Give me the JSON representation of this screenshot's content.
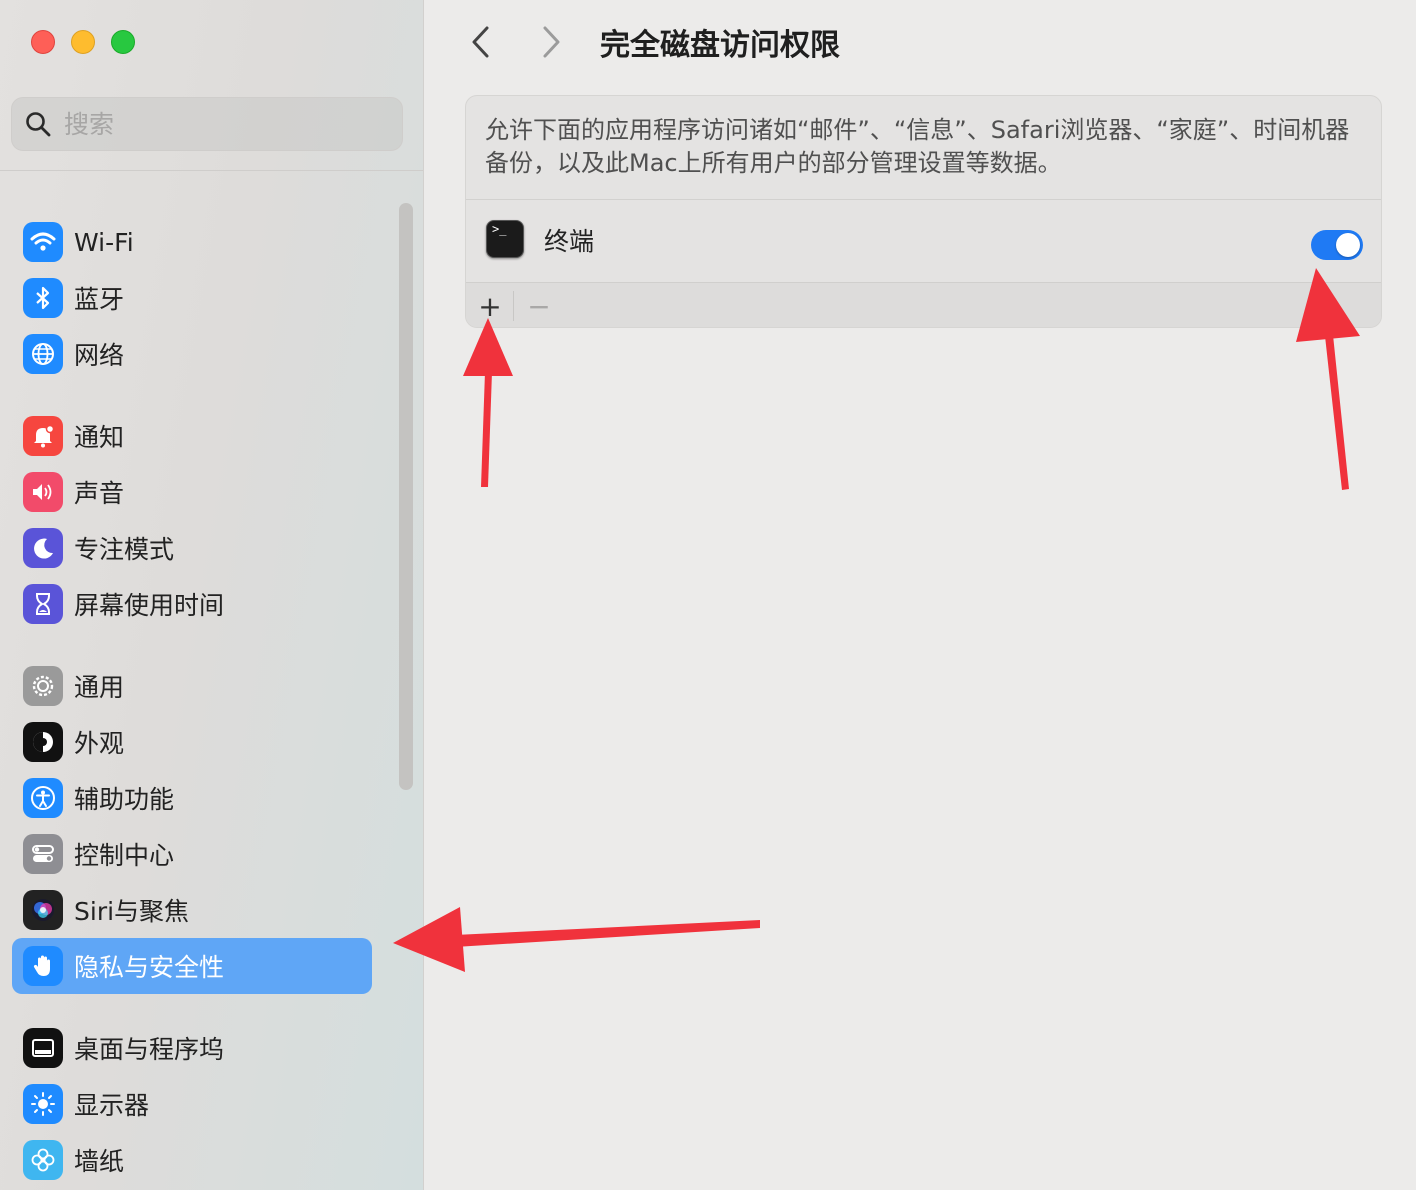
{
  "window": {
    "traffic_lights": [
      "close",
      "minimize",
      "zoom"
    ]
  },
  "sidebar": {
    "search_placeholder": "搜索",
    "items": [
      {
        "label": "Wi-Fi",
        "icon": "wifi-icon",
        "color": "#1f8bff"
      },
      {
        "label": "蓝牙",
        "icon": "bluetooth-icon",
        "color": "#1f8bff"
      },
      {
        "label": "网络",
        "icon": "globe-icon",
        "color": "#1f8bff"
      },
      {
        "label": "通知",
        "icon": "bell-icon",
        "color": "#f6463f"
      },
      {
        "label": "声音",
        "icon": "speaker-icon",
        "color": "#f24b6a"
      },
      {
        "label": "专注模式",
        "icon": "moon-icon",
        "color": "#5a54d8"
      },
      {
        "label": "屏幕使用时间",
        "icon": "hourglass-icon",
        "color": "#5a54d8"
      },
      {
        "label": "通用",
        "icon": "gear-icon",
        "color": "#9a9a9a"
      },
      {
        "label": "外观",
        "icon": "appearance-icon",
        "color": "#111111"
      },
      {
        "label": "辅助功能",
        "icon": "accessibility-icon",
        "color": "#1f8bff"
      },
      {
        "label": "控制中心",
        "icon": "control-center-icon",
        "color": "#8e8e93"
      },
      {
        "label": "Siri与聚焦",
        "icon": "siri-icon",
        "color": "#222222"
      },
      {
        "label": "隐私与安全性",
        "icon": "hand-icon",
        "color": "#1f8bff",
        "selected": true
      },
      {
        "label": "桌面与程序坞",
        "icon": "dock-icon",
        "color": "#111111"
      },
      {
        "label": "显示器",
        "icon": "sun-icon",
        "color": "#1f8bff"
      },
      {
        "label": "墙纸",
        "icon": "flower-icon",
        "color": "#3fb6f0"
      }
    ]
  },
  "main": {
    "title": "完全磁盘访问权限",
    "description": "允许下面的应用程序访问诸如“邮件”、“信息”、Safari浏览器、“家庭”、时间机器备份，以及此Mac上所有用户的部分管理设置等数据。",
    "apps": [
      {
        "name": "终端",
        "icon": "terminal-icon",
        "icon_glyph": ">_",
        "enabled": true
      }
    ],
    "toolbar": {
      "add": "+",
      "remove": "−"
    }
  },
  "colors": {
    "accent": "#1f7af4",
    "selection": "#5fa6f6",
    "annotation_arrow": "#f0323c"
  }
}
